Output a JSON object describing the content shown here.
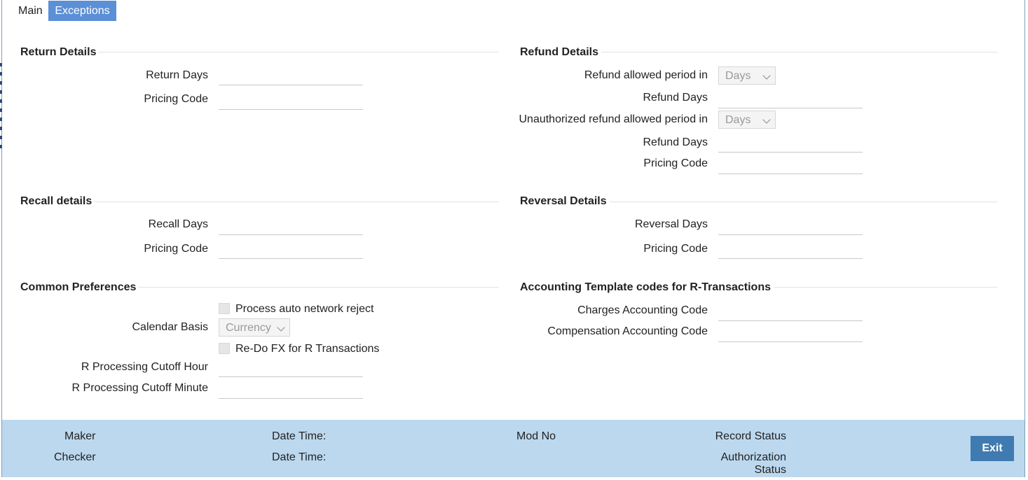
{
  "tabs": {
    "main": "Main",
    "exceptions": "Exceptions"
  },
  "return_details": {
    "title": "Return Details",
    "return_days_label": "Return Days",
    "pricing_code_label": "Pricing Code"
  },
  "refund_details": {
    "title": "Refund Details",
    "allowed_period_label": "Refund allowed period in",
    "allowed_period_value": "Days",
    "refund_days_label": "Refund Days",
    "unauth_period_label": "Unauthorized refund allowed period in",
    "unauth_period_value": "Days",
    "unauth_refund_days_label": "Refund Days",
    "pricing_code_label": "Pricing Code"
  },
  "recall_details": {
    "title": "Recall details",
    "recall_days_label": "Recall Days",
    "pricing_code_label": "Pricing Code"
  },
  "reversal_details": {
    "title": "Reversal Details",
    "reversal_days_label": "Reversal Days",
    "pricing_code_label": "Pricing Code"
  },
  "common_preferences": {
    "title": "Common Preferences",
    "auto_reject_label": "Process auto network reject",
    "calendar_basis_label": "Calendar Basis",
    "calendar_basis_value": "Currency",
    "redo_fx_label": "Re-Do FX for R Transactions",
    "cutoff_hour_label": "R Processing Cutoff Hour",
    "cutoff_minute_label": "R Processing Cutoff Minute"
  },
  "accounting": {
    "title": "Accounting Template codes for R-Transactions",
    "charges_label": "Charges Accounting Code",
    "compensation_label": "Compensation Accounting Code"
  },
  "footer": {
    "maker": "Maker",
    "checker": "Checker",
    "date_time_1": "Date Time:",
    "date_time_2": "Date Time:",
    "mod_no": "Mod No",
    "record_status": "Record Status",
    "authorization": "Authorization",
    "status": "Status",
    "exit": "Exit"
  }
}
